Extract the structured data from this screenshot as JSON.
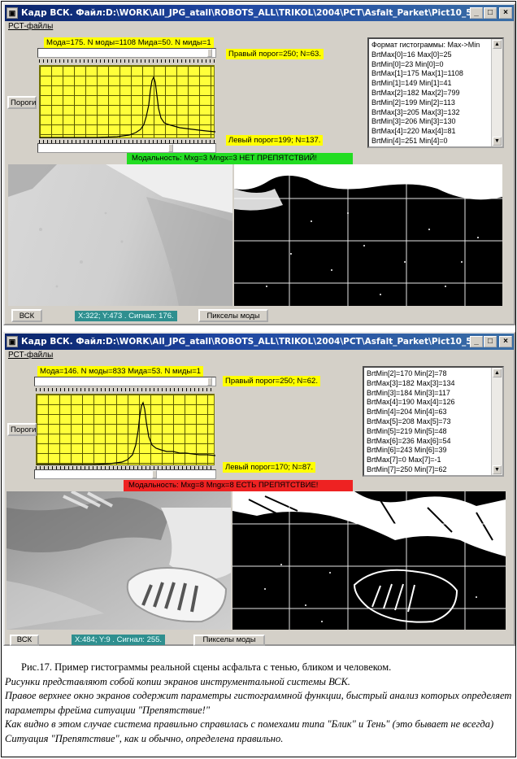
{
  "top_window": {
    "title": "Кадр ВСК.  Файл:D:\\WORK\\All_JPG_atall\\ROBOTS_ALL\\TRIKOL\\2004\\PCT\\Asfalt_Parket\\Pict10_57_55.pct:  Kd...",
    "window_buttons": {
      "minimize": "_",
      "maximize": "□",
      "close": "×"
    },
    "menu": "РСТ-файлы",
    "hist_header": "Мода=175.  N моды=1108 Мида=50.  N миды=1",
    "right_threshold": "Правый порог=250; N=63.",
    "left_threshold": "Левый порог=199; N=137.",
    "modality_text": "Модальность: Mxg=3 Mngx=3                НЕТ ПРЕПЯТСТВИЙ!",
    "modality_color": "#22dd22",
    "thresholds_button": "Пороги",
    "vsk_button": "ВСК",
    "pixels_button": "Пикселы моды",
    "status": "X:322; Y:473 .  Сигнал: 176.",
    "list_items": [
      "Формат гистограммы: Max->Min",
      "BrtMax[0]=16 Max[0]=25",
      "BrtMin[0]=23 Min[0]=0",
      "BrtMax[1]=175 Max[1]=1108",
      "BrtMin[1]=149 Min[1]=41",
      "BrtMax[2]=182 Max[2]=799",
      "BrtMin[2]=199 Min[2]=113",
      "BrtMax[3]=205 Max[3]=132",
      "BrtMin[3]=206 Min[3]=130",
      "BrtMax[4]=220 Max[4]=81",
      "BrtMin[4]=251 Min[4]=0"
    ]
  },
  "bottom_window": {
    "title": "Кадр ВСК.  Файл:D:\\WORK\\All_JPG_atall\\ROBOTS_ALL\\TRIKOL\\2004\\PCT\\Asfalt_Parket\\Pict10_57_53.pct:  Kd...",
    "window_buttons": {
      "minimize": "_",
      "maximize": "□",
      "close": "×"
    },
    "menu": "РСТ-файлы",
    "hist_header": "Мода=146.  N моды=833 Мида=53.  N миды=1",
    "right_threshold": "Правый порог=250; N=62.",
    "left_threshold": "Левый порог=170; N=87.",
    "modality_text": "Модальность: Mxg=8 Mngx=8            ЕСТЬ ПРЕПЯТСТВИЕ!",
    "modality_color": "#ee2222",
    "thresholds_button": "Пороги",
    "vsk_button": "ВСК",
    "pixels_button": "Пикселы моды",
    "status": "X:484; Y:9 .  Сигнал: 255.",
    "list_items": [
      "BrtMin[2]=170 Min[2]=78",
      "BrtMax[3]=182 Max[3]=134",
      "BrtMin[3]=184 Min[3]=117",
      "BrtMax[4]=190 Max[4]=126",
      "BrtMin[4]=204 Min[4]=63",
      "BrtMax[5]=208 Max[5]=73",
      "BrtMin[5]=219 Min[5]=48",
      "BrtMax[6]=236 Max[6]=54",
      "BrtMin[6]=243 Min[6]=39",
      "BrtMax[7]=0 Max[7]=-1",
      "BrtMin[7]=250 Min[7]=62"
    ]
  },
  "caption": {
    "title": "Рис.17. Пример гистограммы реальной сцены асфальта с тенью, бликом и человеком.",
    "line1": " Рисунки представляют собой копии экранов инструментальной системы ВСК.",
    "line2": " Правое верхнее окно экранов содержит параметры гистограммной функции, быстрый анализ которых определяет параметры фрейма ситуации \"Препятствие!\"",
    "line3": "Как видно в этом случае система правильно справилась с помехами типа \"Блик\" и Тень\" (это бывает не всегда)  Ситуация \"Препятствие\", как и обычно, определена правильно."
  }
}
